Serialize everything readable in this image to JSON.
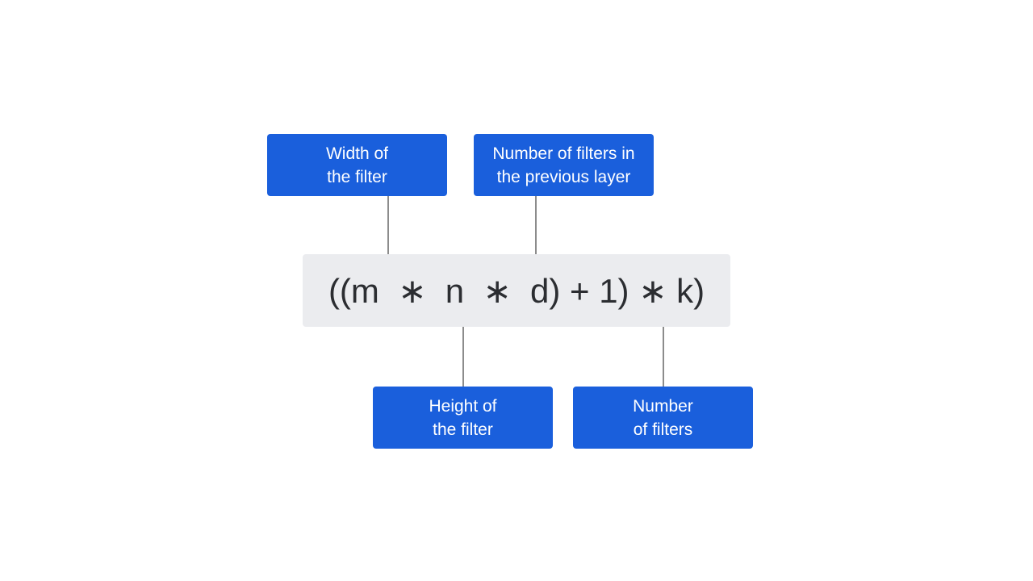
{
  "diagram": {
    "formula": "((m  ∗  n  ∗  d) + 1) ∗ k)",
    "labels": {
      "width": {
        "line1": "Width of",
        "line2": "the filter",
        "refers_to": "m"
      },
      "prev_filters": {
        "line1": "Number of filters in",
        "line2": "the previous layer",
        "refers_to": "d"
      },
      "height": {
        "line1": "Height of",
        "line2": "the filter",
        "refers_to": "n"
      },
      "num_filters": {
        "line1": "Number",
        "line2": "of filters",
        "refers_to": "k"
      }
    },
    "colors": {
      "box": "#1a5fdc",
      "box_text": "#ffffff",
      "formula_bg": "#ebecef",
      "formula_text": "#2b2d31",
      "connector": "#8c8c8c"
    }
  }
}
